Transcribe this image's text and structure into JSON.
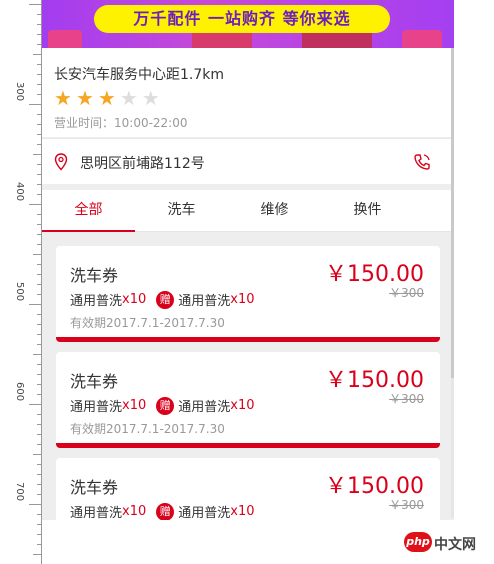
{
  "banner": {
    "text": "万千配件  一站购齐  等你来选"
  },
  "store": {
    "name": "长安汽车服务中心距1.7km",
    "rating": 3,
    "rating_max": 5,
    "hours": "营业时间：10:00-22:00"
  },
  "address": {
    "text": "思明区前埔路112号",
    "pin_icon": "location-pin-icon",
    "phone_icon": "phone-icon"
  },
  "tabs": [
    {
      "label": "全部",
      "active": true
    },
    {
      "label": "洗车",
      "active": false
    },
    {
      "label": "维修",
      "active": false
    },
    {
      "label": "换件",
      "active": false
    }
  ],
  "coupons": [
    {
      "title": "洗车券",
      "item1": "通用普洗",
      "qty1": "x10",
      "gift": "赠",
      "item2": "通用普洗",
      "qty2": "x10",
      "valid": "有效期2017.7.1-2017.7.30",
      "price": "￥150.00",
      "original": "￥300"
    },
    {
      "title": "洗车券",
      "item1": "通用普洗",
      "qty1": "x10",
      "gift": "赠",
      "item2": "通用普洗",
      "qty2": "x10",
      "valid": "有效期2017.7.1-2017.7.30",
      "price": "￥150.00",
      "original": "￥300"
    },
    {
      "title": "洗车券",
      "item1": "通用普洗",
      "qty1": "x10",
      "gift": "赠",
      "item2": "通用普洗",
      "qty2": "x10",
      "valid": "",
      "price": "￥150.00",
      "original": "￥300"
    }
  ],
  "ruler": {
    "labels": [
      "300",
      "400",
      "500",
      "600",
      "700"
    ]
  },
  "watermark": {
    "logo": "php",
    "text": "中文网"
  },
  "colors": {
    "accent": "#d9001b",
    "star": "#f5a623",
    "banner": "#a23df0",
    "highlight": "#fff200"
  }
}
